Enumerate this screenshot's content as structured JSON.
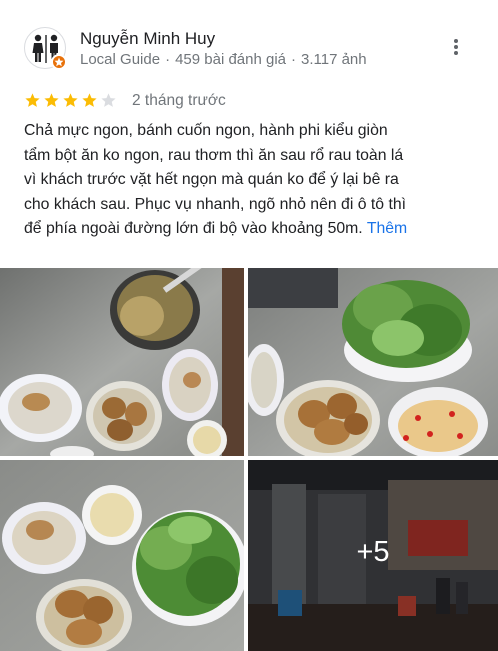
{
  "reviewer": {
    "name": "Nguyễn Minh Huy",
    "local_guide": "Local Guide",
    "review_count": "459 bài đánh giá",
    "photo_count": "3.117 ảnh",
    "separator": "·"
  },
  "rating": {
    "stars": 4,
    "max_stars": 5,
    "time_ago": "2 tháng trước"
  },
  "review": {
    "lines": [
      "Chả mực ngon, bánh cuốn ngon, hành phi kiểu giòn",
      "tẩm bột ăn ko ngon, rau thơm thì ăn sau rổ rau toàn lá",
      "vì khách trước vặt hết ngọn mà quán ko để ý lại bê ra",
      "cho khách sau. Phục vụ nhanh, ngõ nhỏ nên đi ô tô thì",
      "để phía ngoài đường lớn đi bộ vào khoảng 50m."
    ],
    "more_label": "Thêm"
  },
  "photos": {
    "more_count": "+5"
  },
  "colors": {
    "star_filled": "#fbbc04",
    "star_empty": "#dadce0",
    "link": "#1a73e8",
    "badge": "#e8710a"
  },
  "icons": {
    "menu": "more-vert-icon",
    "badge": "local-guide-badge-icon"
  }
}
